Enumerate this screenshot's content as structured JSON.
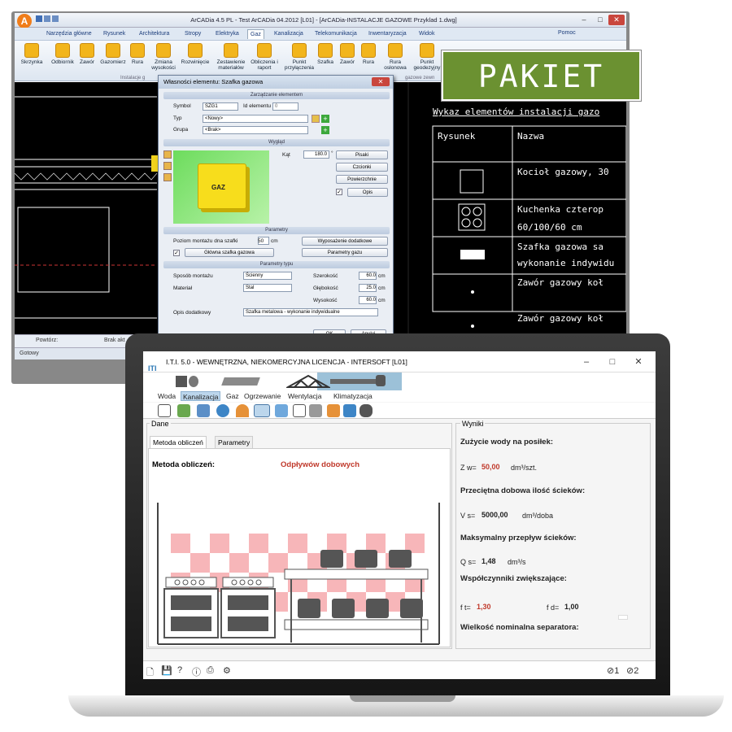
{
  "arcadia": {
    "title": "ArCADia 4.5 PL - Test ArCADia 04.2012 [L01] - [ArCADia-INSTALACJE GAZOWE Przyklad 1.dwg]",
    "logo": "A",
    "menu": [
      "Narzędzia główne",
      "Rysunek",
      "Architektura",
      "Stropy",
      "Elektryka",
      "Gaz",
      "Kanalizacja",
      "Telekomunikacja",
      "Inwentaryzacja",
      "Widok"
    ],
    "help": "Pomoc",
    "ribbon": [
      "Skrzynka",
      "Odbiornik",
      "Zawór",
      "Gazomierz",
      "Rura",
      "Zmiana wysokości",
      "Rozwinięcie",
      "Zestawienie materiałów",
      "Obliczenia i raport",
      "Punkt przyłączenia",
      "Szafka",
      "Zawór",
      "Rura",
      "Rura osłonowa",
      "Punkt geodezyjny"
    ],
    "ribbon_group1": "Instalacje g",
    "ribbon_group2": "gazowe zewn",
    "status_left": "Powtórz:",
    "status_mid": "Brak akt",
    "status_bottom": "Gotowy",
    "cad_table": {
      "title": "Wykaz elementów instalacji gazo",
      "headers": [
        "Rysunek",
        "Nazwa"
      ],
      "rows": [
        "Kocioł gazowy, 30",
        "Kuchenka czterop",
        "60/100/60 cm",
        "Szafka gazowa sa",
        "wykonanie indywidu",
        "Zawór gazowy koł",
        "Zawór gazowy koł"
      ]
    }
  },
  "dialog": {
    "title": "Własności elementu: Szafka gazowa",
    "section1": "Zarządzanie elementem",
    "symbol_label": "Symbol",
    "symbol_value": "SZG1",
    "id_label": "Id elementu",
    "id_value": "0",
    "typ_label": "Typ",
    "typ_value": "<Nowy>",
    "grupa_label": "Grupa",
    "grupa_value": "<Brak>",
    "section2": "Wygląd",
    "kat_label": "Kąt",
    "kat_value": "180.0",
    "kat_unit": "°",
    "btn_pisaki": "Pisaki",
    "btn_czcionki": "Czcionki",
    "btn_powierzchnie": "Powierzchnie",
    "btn_opis": "Opis",
    "gaz_label": "GAZ",
    "section3": "Parametry",
    "poziom_label": "Poziom montażu dna szafki",
    "poziom_value": "50",
    "poziom_unit": "cm",
    "btn_wyposazenie": "Wyposażenie dodatkowe",
    "glowna_value": "Główna szafka gazowa",
    "btn_parametry_gazu": "Parametry gazu",
    "section4": "Parametry typu",
    "sposob_label": "Sposób montażu",
    "sposob_value": "Ścienny",
    "material_label": "Materiał",
    "material_value": "Stal",
    "szer_label": "Szerokość",
    "szer_value": "60.0",
    "gleb_label": "Głębokość",
    "gleb_value": "25.0",
    "wys_label": "Wysokość",
    "wys_value": "60.0",
    "unit_cm": "cm",
    "opis_label": "Opis dodatkowy",
    "opis_value": "Szafka metalowa - wykonanie indywidualne",
    "btn_ok": "OK",
    "btn_anuluj": "Anuluj"
  },
  "badge": "PAKIET",
  "iti": {
    "title": "I.T.I. 5.0 - WEWNĘTRZNA, NIEKOMERCYJNA LICENCJA - INTERSOFT [L01]",
    "tabs": [
      "Woda",
      "Kanalizacja",
      "Gaz",
      "Ogrzewanie",
      "Wentylacja",
      "Klimatyzacja"
    ],
    "dane_label": "Dane",
    "wyniki_label": "Wyniki",
    "subtab1": "Metoda obliczeń",
    "subtab2": "Parametry",
    "method_label": "Metoda obliczeń:",
    "method_value": "Odpływów dobowych",
    "res1_title": "Zużycie wody na posiłek:",
    "res1_sym": "Z w=",
    "res1_val": "50,00",
    "res1_unit": "dm³/szt.",
    "res2_title": "Przeciętna dobowa ilość ścieków:",
    "res2_sym": "V s=",
    "res2_val": "5000,00",
    "res2_unit": "dm³/doba",
    "res3_title": "Maksymalny przepływ ścieków:",
    "res3_sym": "Q s=",
    "res3_val": "1,48",
    "res3_unit": "dm³/s",
    "res4_title": "Współczynniki zwiększające:",
    "ft_sym": "f t=",
    "ft_val": "1,30",
    "fd_sym": "f d=",
    "fd_val": "1,00",
    "res5_title": "Wielkość nominalna separatora:",
    "bottom_status1": "1",
    "bottom_status2": "2"
  }
}
